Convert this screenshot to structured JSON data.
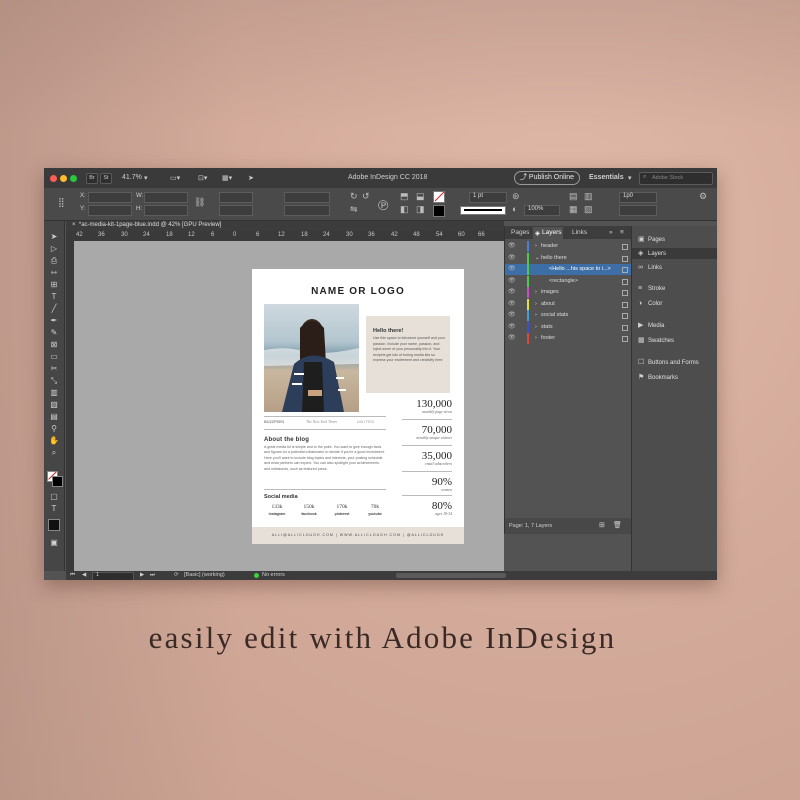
{
  "app": {
    "title": "Adobe InDesign CC 2018",
    "zoom": "41.7%",
    "publish_label": "Publish Online",
    "workspace": "Essentials",
    "search_placeholder": "Adobe Stock",
    "icon_br": "Br",
    "icon_st": "St"
  },
  "controlbar": {
    "x_label": "X:",
    "y_label": "Y:",
    "w_label": "W:",
    "h_label": "H:",
    "stroke_weight": "1 pt",
    "scale": "100%",
    "value_1p0": "1p0"
  },
  "document_tab": {
    "label": "*ac-media-kit-1page-blue.indd @ 42% [GPU Preview]",
    "close": "×"
  },
  "ruler": {
    "ticks": [
      "42",
      "36",
      "30",
      "24",
      "18",
      "12",
      "6",
      "0",
      "6",
      "12",
      "18",
      "24",
      "30",
      "36",
      "42",
      "48",
      "54",
      "60",
      "66",
      "72"
    ]
  },
  "document": {
    "logo": "NAME OR LOGO",
    "hello_title": "Hello there!",
    "hello_text": "Use this space to introduce yourself and your passion. Include your name, passion, and inject some of your personality into it. Your recipeis get lots of boring media kits so express your excitement and creativity here.",
    "press": [
      "BUZZFEED",
      "The New York Times",
      "UNITED"
    ],
    "about_title": "About the blog",
    "about_text": "A great media kit is simple and to the point. You want to give enough facts and figures for a potential collaborator to decide if you're a good investment. Here you'll want to include blog topics and interests, your posting schedule and what partners can expect. You can also spotlight your achievements and milestones, such as featured press.",
    "social_title": "Social media",
    "social": [
      {
        "value": "133k",
        "label": "instagram"
      },
      {
        "value": "150k",
        "label": "facebook"
      },
      {
        "value": "170k",
        "label": "pinterest"
      },
      {
        "value": "70k",
        "label": "youtube"
      }
    ],
    "stats": [
      {
        "value": "130,000",
        "label": "monthly page views"
      },
      {
        "value": "70,000",
        "label": "monthly unique visitors"
      },
      {
        "value": "35,000",
        "label": "email subscribers"
      },
      {
        "value": "90%",
        "label": "women"
      },
      {
        "value": "80%",
        "label": "ages 18-34"
      }
    ],
    "footer": "ALLI@ALLICLOUGH.COM  |  WWW.ALLICLOUGH.COM  |  @ALLICLOUGH"
  },
  "layers_panel": {
    "tabs": [
      "Pages",
      "Layers",
      "Links"
    ],
    "active_tab": "Layers",
    "rows": [
      {
        "name": "header",
        "color": "#4a7fd4",
        "indent": 0,
        "expander": "›"
      },
      {
        "name": "hello there",
        "color": "#4ec94e",
        "indent": 0,
        "expander": "⌄"
      },
      {
        "name": "<Hello ...his space to i...>",
        "color": "#4ec94e",
        "indent": 2,
        "expander": "",
        "selected": true
      },
      {
        "name": "<rectangle>",
        "color": "#4ec94e",
        "indent": 2,
        "expander": ""
      },
      {
        "name": "images",
        "color": "#c64ec6",
        "indent": 0,
        "expander": "›"
      },
      {
        "name": "about",
        "color": "#e0e042",
        "indent": 0,
        "expander": "›"
      },
      {
        "name": "social stats",
        "color": "#3fa0d6",
        "indent": 0,
        "expander": "›"
      },
      {
        "name": "stats",
        "color": "#3b4fd0",
        "indent": 0,
        "expander": "›"
      },
      {
        "name": "footer",
        "color": "#d64a3a",
        "indent": 0,
        "expander": "›"
      }
    ],
    "footer": "Page: 1, 7 Layers"
  },
  "dock": {
    "items": [
      {
        "label": "Pages",
        "icon": "pages-icon"
      },
      {
        "label": "Layers",
        "icon": "layers-icon"
      },
      {
        "label": "Links",
        "icon": "links-icon"
      },
      {
        "label": "Stroke",
        "icon": "stroke-icon"
      },
      {
        "label": "Color",
        "icon": "color-icon"
      },
      {
        "label": "Media",
        "icon": "media-icon"
      },
      {
        "label": "Swatches",
        "icon": "swatches-icon"
      },
      {
        "label": "Buttons and Forms",
        "icon": "buttons-forms-icon"
      },
      {
        "label": "Bookmarks",
        "icon": "bookmarks-icon"
      }
    ]
  },
  "statusbar": {
    "page": "1",
    "style": "[Basic] (working)",
    "errors": "No errors"
  },
  "caption": "easily edit with Adobe InDesign"
}
